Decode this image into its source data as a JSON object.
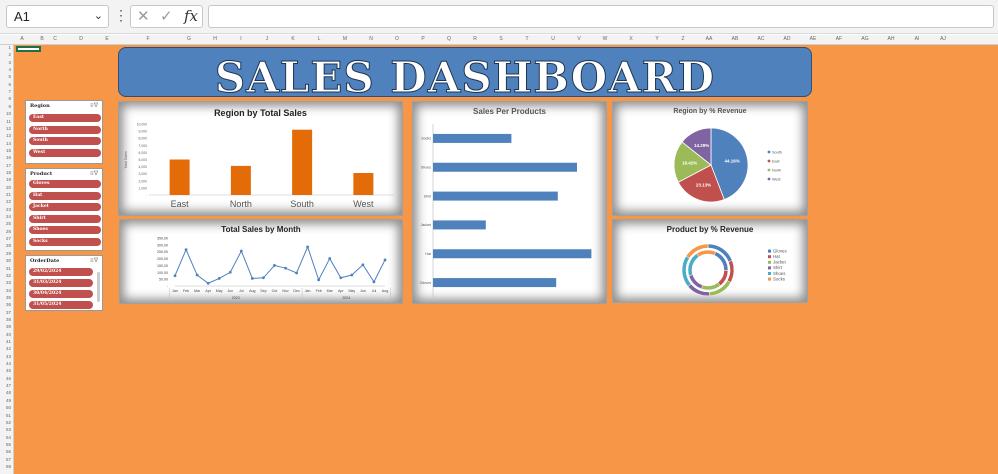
{
  "formula_bar": {
    "name_box": "A1",
    "fx": "fx",
    "formula": ""
  },
  "columns": [
    "A",
    "B",
    "C",
    "D",
    "E",
    "F",
    "G",
    "H",
    "I",
    "J",
    "K",
    "L",
    "M",
    "N",
    "O",
    "P",
    "Q",
    "R",
    "S",
    "T",
    "U",
    "V",
    "W",
    "X",
    "Y",
    "Z",
    "AA",
    "AB",
    "AC",
    "AD",
    "AE",
    "AF",
    "AG",
    "AH",
    "AI",
    "AJ"
  ],
  "rows_count": 58,
  "dashboard_title": "SALES DASHBOARD",
  "slicers": {
    "region": {
      "header": "Region",
      "items": [
        "East",
        "North",
        "South",
        "West"
      ]
    },
    "product": {
      "header": "Product",
      "items": [
        "Gloves",
        "Hat",
        "Jacket",
        "Shirt",
        "Shoes",
        "Socks"
      ]
    },
    "order_date": {
      "header": "OrderDate",
      "items": [
        "29/02/2024",
        "31/03/2024",
        "30/04/2024",
        "31/05/2024"
      ]
    }
  },
  "colors": {
    "sheet_bg": "#f79646",
    "title_bg": "#4f81bd",
    "bar_orange": "#e36c09",
    "bar_blue": "#4f81bd",
    "slicer_item": "#c0504d"
  },
  "chart_data": [
    {
      "id": "region_total",
      "type": "bar",
      "title": "Region by Total Sales",
      "ylabel": "Total Sales",
      "categories": [
        "East",
        "North",
        "South",
        "West"
      ],
      "values": [
        5000,
        4100,
        9200,
        3100
      ],
      "ylim": [
        0,
        10000
      ],
      "yticks": [
        "10,000",
        "9,000",
        "8,000",
        "7,000",
        "6,000",
        "5,000",
        "4,000",
        "3,000",
        "2,000",
        "1,000",
        "-"
      ],
      "grid": false
    },
    {
      "id": "sales_per_product",
      "type": "bar",
      "orientation": "horizontal",
      "title": "Sales Per Products",
      "categories": [
        "Socks",
        "Shoes",
        "Shirt",
        "Jacket",
        "Hat",
        "Gloves"
      ],
      "values": [
        0.49,
        0.9,
        0.78,
        0.33,
        0.99,
        0.77
      ]
    },
    {
      "id": "region_pct",
      "type": "pie",
      "title": "Region by % Revenue",
      "labels": [
        "South",
        "East",
        "North",
        "West"
      ],
      "values": [
        44.16,
        23.13,
        18.42,
        14.29
      ],
      "data_labels": [
        "44.16%",
        "23.13%",
        "18.42%",
        "14.29%"
      ],
      "colors": [
        "#4f81bd",
        "#c0504d",
        "#9bbb59",
        "#8064a2"
      ],
      "legend": "right"
    },
    {
      "id": "sales_by_month",
      "type": "line",
      "title": "Total Sales by Month",
      "x": [
        "Jan",
        "Feb",
        "Mar",
        "Apr",
        "May",
        "Jun",
        "Jul",
        "Aug",
        "Sep",
        "Oct",
        "Nov",
        "Dec",
        "Jan",
        "Feb",
        "Mar",
        "Apr",
        "May",
        "Jun",
        "Jul",
        "Aug"
      ],
      "year_groups": [
        {
          "label": "2023",
          "count": 12
        },
        {
          "label": "2024",
          "count": 8
        }
      ],
      "values": [
        75000,
        265000,
        80000,
        20000,
        55000,
        100000,
        255000,
        55000,
        60000,
        150000,
        130000,
        95000,
        285000,
        45000,
        200000,
        60000,
        80000,
        155000,
        30000,
        190000
      ],
      "ylim": [
        0,
        350000
      ],
      "yticks": [
        "350,00",
        "300,00",
        "250,00",
        "200,00",
        "150,00",
        "100,00",
        "50,00",
        "-"
      ]
    },
    {
      "id": "product_pct",
      "type": "pie",
      "subtype": "doughnut",
      "title": "Product by % Revenue",
      "labels": [
        "Gloves",
        "Hat",
        "Jacket",
        "Shirt",
        "Shoes",
        "Socks"
      ],
      "colors": [
        "#4f81bd",
        "#c0504d",
        "#9bbb59",
        "#8064a2",
        "#4bacc6",
        "#f79646"
      ],
      "legend": "right"
    }
  ]
}
